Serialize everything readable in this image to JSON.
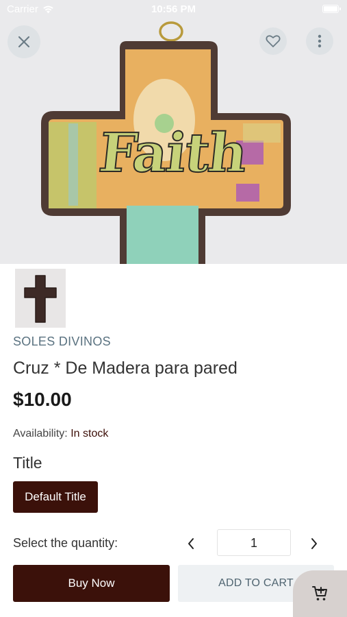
{
  "status_bar": {
    "carrier": "Carrier",
    "time": "10:56 PM"
  },
  "hero": {
    "icons": {
      "close": "close-icon",
      "favorite": "heart-icon",
      "more": "more-vertical-icon"
    },
    "art_text": "Faith"
  },
  "product": {
    "vendor": "SOLES DIVINOS",
    "title": "Cruz * De Madera para pared",
    "price": "$10.00",
    "availability_label": "Availability:",
    "availability_value": "In stock",
    "option_name": "Title",
    "option_value": "Default Title"
  },
  "quantity": {
    "label": "Select the quantity:",
    "value": "1"
  },
  "actions": {
    "buy_now": "Buy Now",
    "add_to_cart": "ADD TO CART",
    "cart_icon": "cart-add-icon"
  },
  "colors": {
    "primary": "#3b110a",
    "vendor": "#5a7280",
    "secondary_bg": "#eef1f3"
  }
}
